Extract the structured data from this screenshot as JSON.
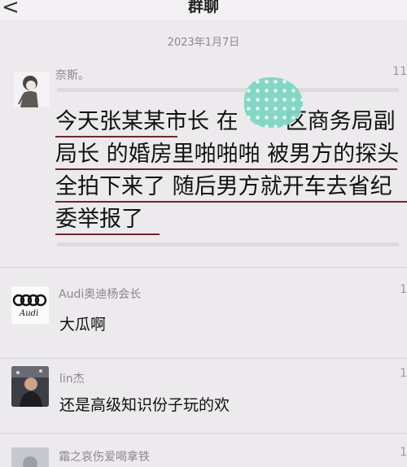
{
  "header": {
    "back_label": "<",
    "title": "群聊"
  },
  "date_separator": "2023年1月7日",
  "messages": [
    {
      "sender": "奈斯。",
      "time": "11",
      "lines": [
        "今天张某某市长 在",
        "区商务局副",
        "局长 的婚房里啪啪啪 被男方的探头",
        "全拍下来了 随后男方就开车去省纪",
        "委举报了"
      ]
    },
    {
      "sender": "Audi奥迪杨会长",
      "time": "1",
      "text": "大瓜啊",
      "avatar_caption": "Audi"
    },
    {
      "sender": "lin杰",
      "time": "1",
      "text": "还是高级知识份子玩的欢"
    },
    {
      "sender": "霜之哀伤爱喝拿铁",
      "time": "1"
    }
  ]
}
